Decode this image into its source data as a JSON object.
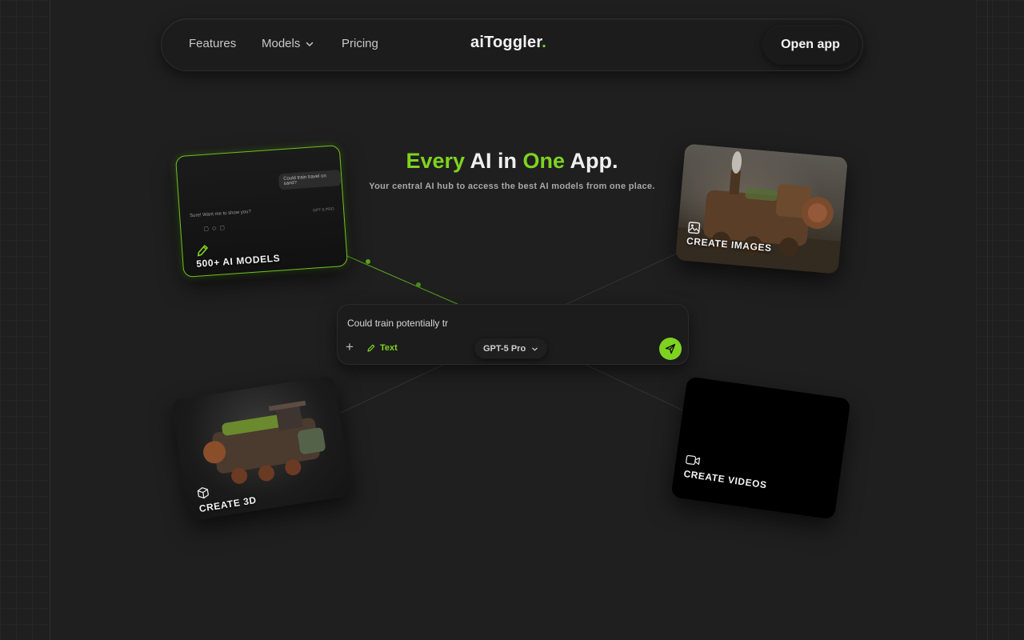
{
  "nav": {
    "features_label": "Features",
    "models_label": "Models",
    "pricing_label": "Pricing",
    "logo_text": "aiToggler",
    "logo_dot": ".",
    "open_app_label": "Open app"
  },
  "hero": {
    "title_word1": "Every",
    "title_word2": "AI in",
    "title_word3": "One",
    "title_word4": "App.",
    "subtitle": "Your central AI hub to access the best AI models from one place."
  },
  "cards": {
    "models": {
      "label": "500+ AI MODELS",
      "preview_user_message": "Could train travel on sand?",
      "preview_reply": "Sure! Want me to show you?",
      "preview_model": "GPT-5 PRO"
    },
    "images": {
      "label": "CREATE IMAGES"
    },
    "threed": {
      "label": "CREATE 3D"
    },
    "videos": {
      "label": "CREATE VIDEOS"
    }
  },
  "chat": {
    "input_value": "Could train potentially tr",
    "add_label": "+",
    "mode_label": "Text",
    "model_label": "GPT-5 Pro"
  },
  "colors": {
    "accent": "#7ed321",
    "background": "#1f1f1f"
  },
  "icons": {
    "models_card": "pencil-icon",
    "images_card": "image-icon",
    "threed_card": "cube-icon",
    "videos_card": "video-camera-icon",
    "send": "send-icon",
    "models_dropdown": "chevron-down-icon"
  }
}
